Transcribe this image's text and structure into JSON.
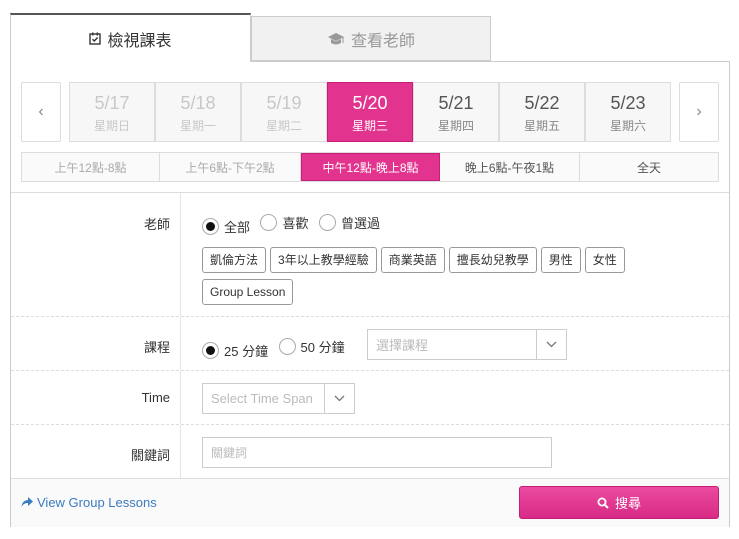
{
  "tabs": {
    "schedule": "檢視課表",
    "teachers": "查看老師"
  },
  "dates": [
    {
      "date": "5/17",
      "weekday": "星期日",
      "state": "past"
    },
    {
      "date": "5/18",
      "weekday": "星期一",
      "state": "past"
    },
    {
      "date": "5/19",
      "weekday": "星期二",
      "state": "past"
    },
    {
      "date": "5/20",
      "weekday": "星期三",
      "state": "active"
    },
    {
      "date": "5/21",
      "weekday": "星期四",
      "state": "future"
    },
    {
      "date": "5/22",
      "weekday": "星期五",
      "state": "future"
    },
    {
      "date": "5/23",
      "weekday": "星期六",
      "state": "future"
    }
  ],
  "nav": {
    "prev": "‹",
    "next": "›"
  },
  "time_slots": [
    {
      "label": "上午12點-8點",
      "state": "past"
    },
    {
      "label": "上午6點-下午2點",
      "state": "past"
    },
    {
      "label": "中午12點-晚上8點",
      "state": "active"
    },
    {
      "label": "晚上6點-午夜1點",
      "state": "normal"
    },
    {
      "label": "全天",
      "state": "normal"
    }
  ],
  "teacher_filter": {
    "label": "老師",
    "options": [
      "全部",
      "喜歡",
      "曾選過"
    ],
    "selected": "全部",
    "tags": [
      "凱倫方法",
      "3年以上教學經驗",
      "商業英語",
      "擅長幼兒教學",
      "男性",
      "女性",
      "Group Lesson"
    ]
  },
  "course_filter": {
    "label": "課程",
    "options": [
      "25 分鐘",
      "50 分鐘"
    ],
    "selected": "25 分鐘",
    "select_placeholder": "選擇課程"
  },
  "time_filter": {
    "label": "Time",
    "select_placeholder": "Select Time Span"
  },
  "keyword_filter": {
    "label": "關鍵詞",
    "placeholder": "關鍵詞"
  },
  "footer": {
    "group_link": "View Group Lessons",
    "search_button": "搜尋"
  },
  "colors": {
    "accent": "#e2348e",
    "link": "#3b7bbf"
  }
}
